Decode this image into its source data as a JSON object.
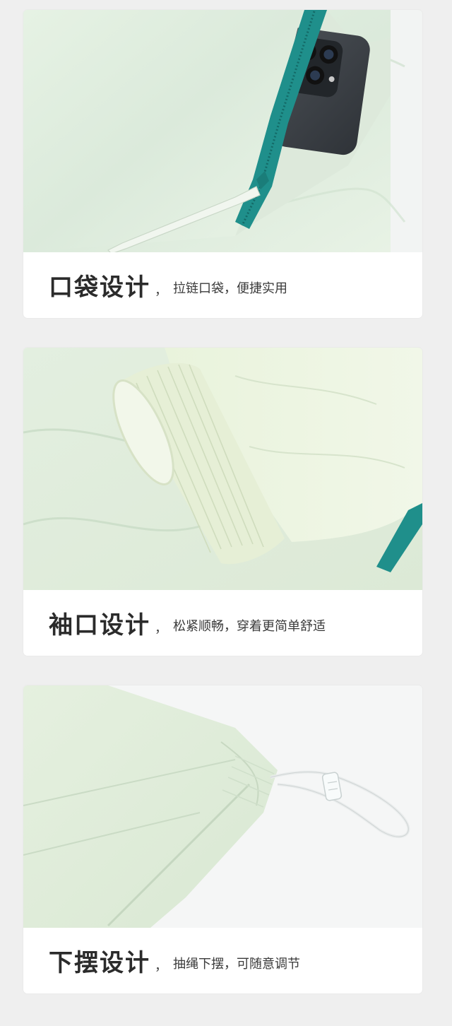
{
  "page": {
    "background": "#efefef",
    "accent_zipper": "#1f8f8b",
    "fabric": "#e3f0e2"
  },
  "sections": [
    {
      "title": "口袋设计",
      "separator": "，",
      "description": "拉链口袋，便捷实用",
      "image": "pocket-zipper-with-phone"
    },
    {
      "title": "袖口设计",
      "separator": "，",
      "description": "松紧顺畅，穿着更简单舒适",
      "image": "elastic-cuff"
    },
    {
      "title": "下摆设计",
      "separator": "，",
      "description": "抽绳下摆，可随意调节",
      "image": "drawstring-hem"
    }
  ]
}
